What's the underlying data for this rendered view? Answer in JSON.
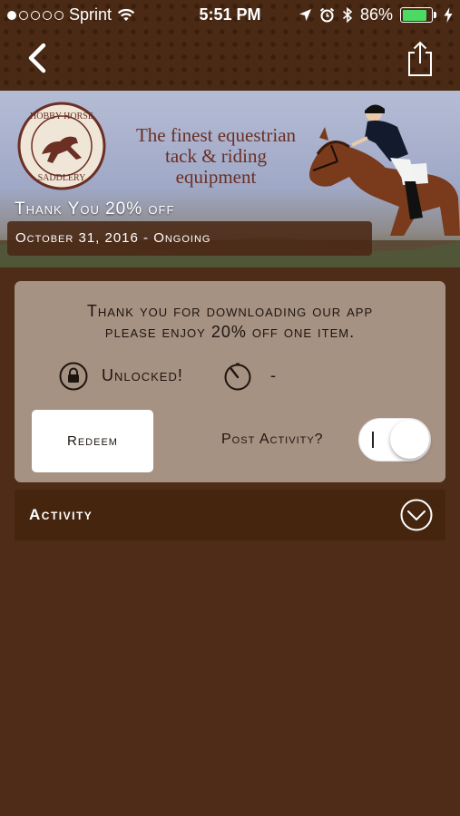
{
  "status_bar": {
    "carrier": "Sprint",
    "signal_dots_filled": 1,
    "signal_dots_total": 5,
    "time": "5:51 PM",
    "battery_percent": "86%",
    "battery_level": 0.86,
    "battery_color": "#4cd964",
    "icons": [
      "wifi-icon",
      "location-arrow-icon",
      "alarm-icon",
      "bluetooth-icon",
      "charging-bolt-icon"
    ]
  },
  "nav": {
    "back_icon": "chevron-left-icon",
    "share_icon": "share-icon"
  },
  "hero": {
    "logo_text_top": "HOBBY HORSE",
    "logo_text_bottom": "SADDLERY",
    "tagline_line1": "The finest equestrian",
    "tagline_line2": "tack & riding equipment",
    "title": "Thank You 20% off",
    "date_range": "October 31, 2016 - Ongoing"
  },
  "offer": {
    "description_line1": "Thank you for downloading our app",
    "description_line2": "please enjoy 20% off one item.",
    "status_label": "Unlocked!",
    "timer_value": "-",
    "redeem_label": "Redeem",
    "post_activity_label": "Post Activity?",
    "post_activity_enabled": true
  },
  "activity": {
    "label": "Activity"
  },
  "colors": {
    "background": "#4f2c17",
    "card": "#a69282",
    "tagline": "#6b2f24"
  }
}
